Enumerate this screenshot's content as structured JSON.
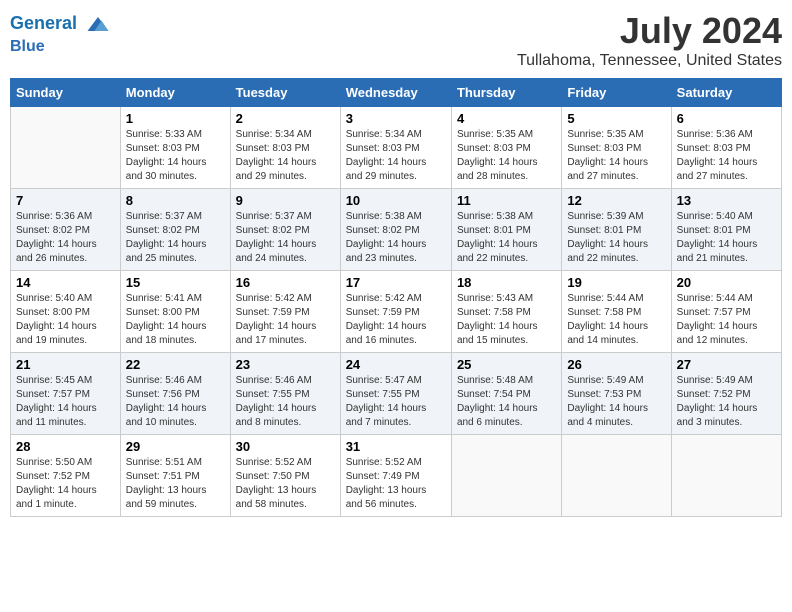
{
  "header": {
    "logo_line1": "General",
    "logo_line2": "Blue",
    "month_year": "July 2024",
    "location": "Tullahoma, Tennessee, United States"
  },
  "weekdays": [
    "Sunday",
    "Monday",
    "Tuesday",
    "Wednesday",
    "Thursday",
    "Friday",
    "Saturday"
  ],
  "weeks": [
    [
      {
        "day": "",
        "info": ""
      },
      {
        "day": "1",
        "info": "Sunrise: 5:33 AM\nSunset: 8:03 PM\nDaylight: 14 hours\nand 30 minutes."
      },
      {
        "day": "2",
        "info": "Sunrise: 5:34 AM\nSunset: 8:03 PM\nDaylight: 14 hours\nand 29 minutes."
      },
      {
        "day": "3",
        "info": "Sunrise: 5:34 AM\nSunset: 8:03 PM\nDaylight: 14 hours\nand 29 minutes."
      },
      {
        "day": "4",
        "info": "Sunrise: 5:35 AM\nSunset: 8:03 PM\nDaylight: 14 hours\nand 28 minutes."
      },
      {
        "day": "5",
        "info": "Sunrise: 5:35 AM\nSunset: 8:03 PM\nDaylight: 14 hours\nand 27 minutes."
      },
      {
        "day": "6",
        "info": "Sunrise: 5:36 AM\nSunset: 8:03 PM\nDaylight: 14 hours\nand 27 minutes."
      }
    ],
    [
      {
        "day": "7",
        "info": "Sunrise: 5:36 AM\nSunset: 8:02 PM\nDaylight: 14 hours\nand 26 minutes."
      },
      {
        "day": "8",
        "info": "Sunrise: 5:37 AM\nSunset: 8:02 PM\nDaylight: 14 hours\nand 25 minutes."
      },
      {
        "day": "9",
        "info": "Sunrise: 5:37 AM\nSunset: 8:02 PM\nDaylight: 14 hours\nand 24 minutes."
      },
      {
        "day": "10",
        "info": "Sunrise: 5:38 AM\nSunset: 8:02 PM\nDaylight: 14 hours\nand 23 minutes."
      },
      {
        "day": "11",
        "info": "Sunrise: 5:38 AM\nSunset: 8:01 PM\nDaylight: 14 hours\nand 22 minutes."
      },
      {
        "day": "12",
        "info": "Sunrise: 5:39 AM\nSunset: 8:01 PM\nDaylight: 14 hours\nand 22 minutes."
      },
      {
        "day": "13",
        "info": "Sunrise: 5:40 AM\nSunset: 8:01 PM\nDaylight: 14 hours\nand 21 minutes."
      }
    ],
    [
      {
        "day": "14",
        "info": "Sunrise: 5:40 AM\nSunset: 8:00 PM\nDaylight: 14 hours\nand 19 minutes."
      },
      {
        "day": "15",
        "info": "Sunrise: 5:41 AM\nSunset: 8:00 PM\nDaylight: 14 hours\nand 18 minutes."
      },
      {
        "day": "16",
        "info": "Sunrise: 5:42 AM\nSunset: 7:59 PM\nDaylight: 14 hours\nand 17 minutes."
      },
      {
        "day": "17",
        "info": "Sunrise: 5:42 AM\nSunset: 7:59 PM\nDaylight: 14 hours\nand 16 minutes."
      },
      {
        "day": "18",
        "info": "Sunrise: 5:43 AM\nSunset: 7:58 PM\nDaylight: 14 hours\nand 15 minutes."
      },
      {
        "day": "19",
        "info": "Sunrise: 5:44 AM\nSunset: 7:58 PM\nDaylight: 14 hours\nand 14 minutes."
      },
      {
        "day": "20",
        "info": "Sunrise: 5:44 AM\nSunset: 7:57 PM\nDaylight: 14 hours\nand 12 minutes."
      }
    ],
    [
      {
        "day": "21",
        "info": "Sunrise: 5:45 AM\nSunset: 7:57 PM\nDaylight: 14 hours\nand 11 minutes."
      },
      {
        "day": "22",
        "info": "Sunrise: 5:46 AM\nSunset: 7:56 PM\nDaylight: 14 hours\nand 10 minutes."
      },
      {
        "day": "23",
        "info": "Sunrise: 5:46 AM\nSunset: 7:55 PM\nDaylight: 14 hours\nand 8 minutes."
      },
      {
        "day": "24",
        "info": "Sunrise: 5:47 AM\nSunset: 7:55 PM\nDaylight: 14 hours\nand 7 minutes."
      },
      {
        "day": "25",
        "info": "Sunrise: 5:48 AM\nSunset: 7:54 PM\nDaylight: 14 hours\nand 6 minutes."
      },
      {
        "day": "26",
        "info": "Sunrise: 5:49 AM\nSunset: 7:53 PM\nDaylight: 14 hours\nand 4 minutes."
      },
      {
        "day": "27",
        "info": "Sunrise: 5:49 AM\nSunset: 7:52 PM\nDaylight: 14 hours\nand 3 minutes."
      }
    ],
    [
      {
        "day": "28",
        "info": "Sunrise: 5:50 AM\nSunset: 7:52 PM\nDaylight: 14 hours\nand 1 minute."
      },
      {
        "day": "29",
        "info": "Sunrise: 5:51 AM\nSunset: 7:51 PM\nDaylight: 13 hours\nand 59 minutes."
      },
      {
        "day": "30",
        "info": "Sunrise: 5:52 AM\nSunset: 7:50 PM\nDaylight: 13 hours\nand 58 minutes."
      },
      {
        "day": "31",
        "info": "Sunrise: 5:52 AM\nSunset: 7:49 PM\nDaylight: 13 hours\nand 56 minutes."
      },
      {
        "day": "",
        "info": ""
      },
      {
        "day": "",
        "info": ""
      },
      {
        "day": "",
        "info": ""
      }
    ]
  ]
}
